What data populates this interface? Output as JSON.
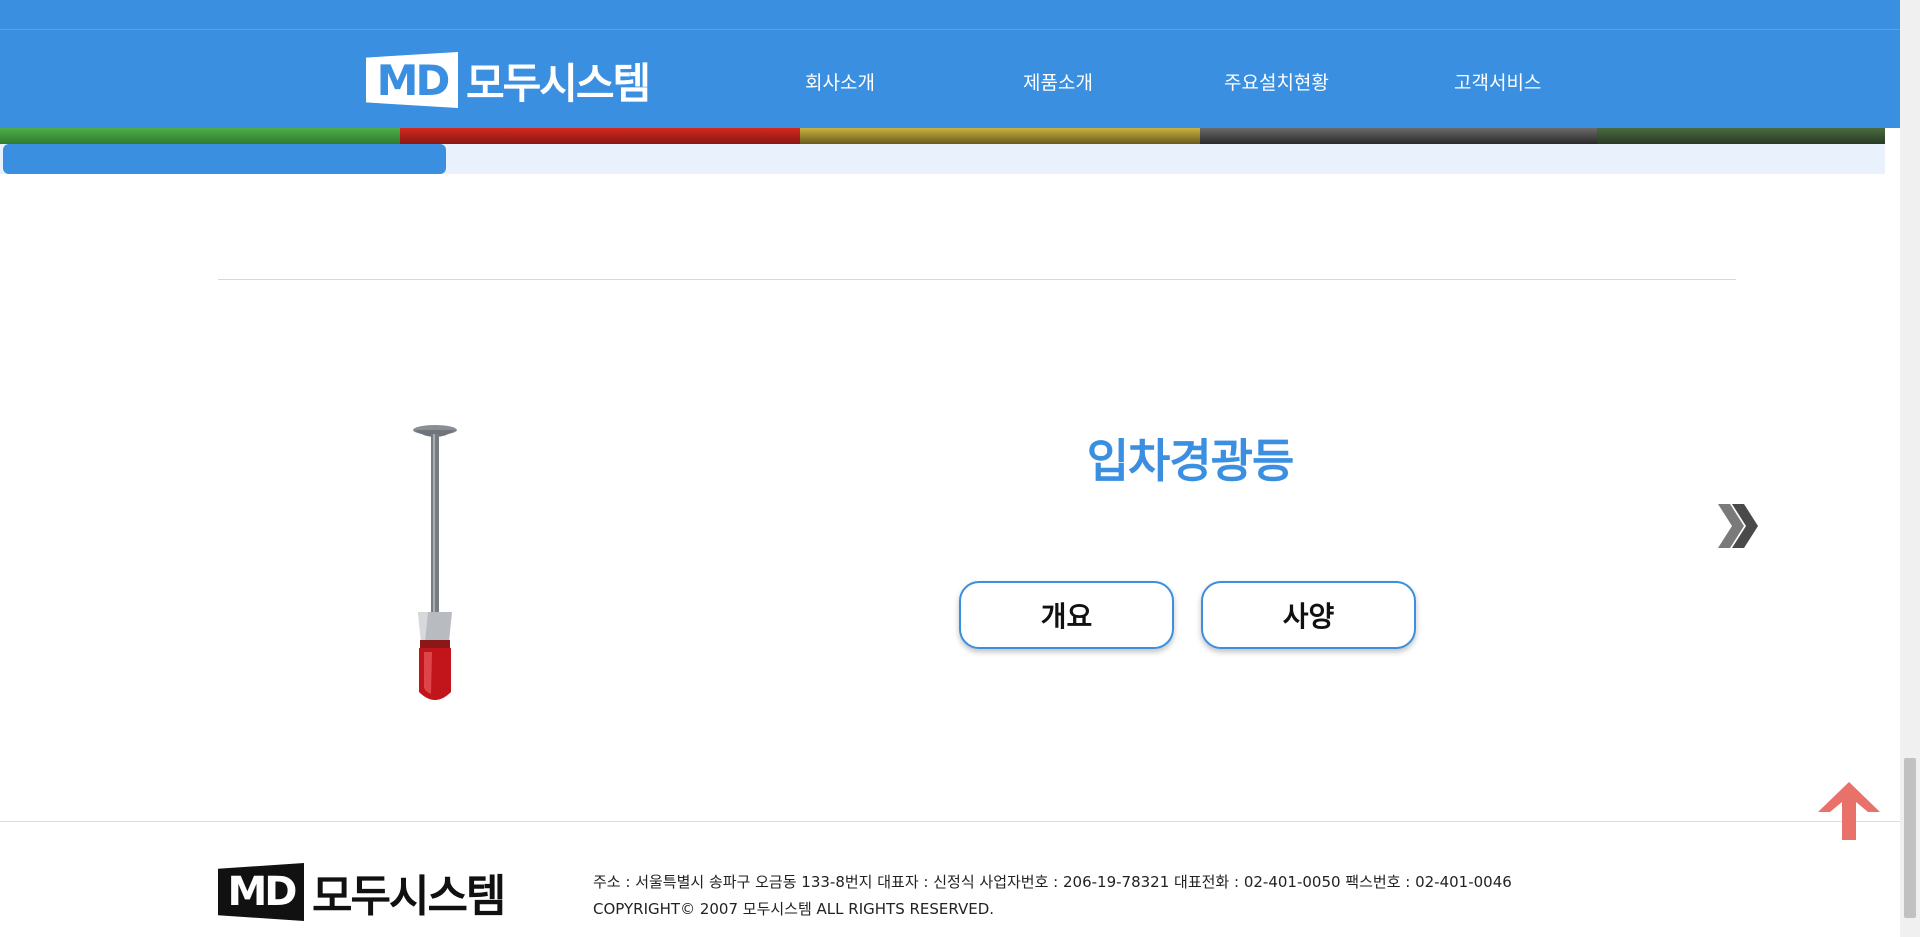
{
  "header": {
    "logo_mark": "MD",
    "logo_text": "모두시스템",
    "nav": [
      {
        "label": "회사소개"
      },
      {
        "label": "제품소개"
      },
      {
        "label": "주요설치현황"
      },
      {
        "label": "고객서비스"
      }
    ]
  },
  "product": {
    "title": "입차경광등",
    "buttons": {
      "overview": "개요",
      "spec": "사양"
    }
  },
  "footer": {
    "logo_mark": "MD",
    "logo_text": "모두시스템",
    "address_line": "주소 : 서울특별시 송파구 오금동 133-8번지 대표자 : 신정식 사업자번호 : 206-19-78321 대표전화 : 02-401-0050 팩스번호 : 02-401-0046",
    "copyright": "COPYRIGHT© 2007 모두시스템 ALL RIGHTS RESERVED."
  },
  "colors": {
    "brand": "#3a8fe1",
    "to_top_arrow": "#e8716a"
  },
  "icons": [
    "next-chevron-icon",
    "scroll-to-top-icon"
  ]
}
